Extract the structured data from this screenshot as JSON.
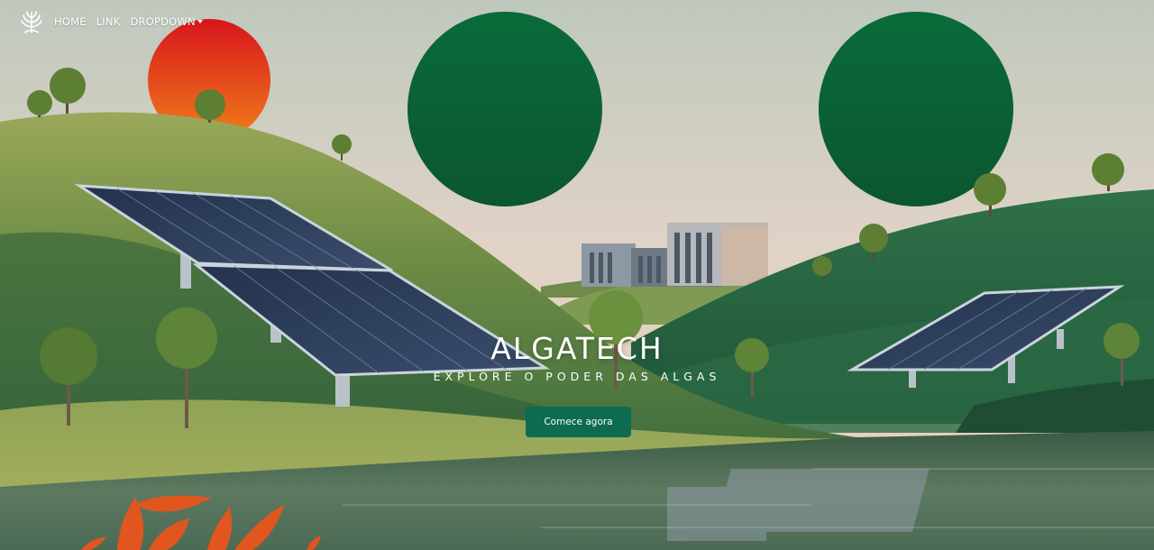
{
  "nav": {
    "brand_icon": "seaweed-plant-icon",
    "links": [
      {
        "label": "HOME"
      },
      {
        "label": "LINK"
      },
      {
        "label": "DROPDOWN",
        "icon": "caret-down-icon"
      }
    ]
  },
  "hero": {
    "title": "ALGATECH",
    "subtitle": "EXPLORE O PODER DAS ALGAS",
    "cta_label": "Comece agora"
  },
  "colors": {
    "accent": "#0c6b51",
    "text": "#ffffff"
  }
}
